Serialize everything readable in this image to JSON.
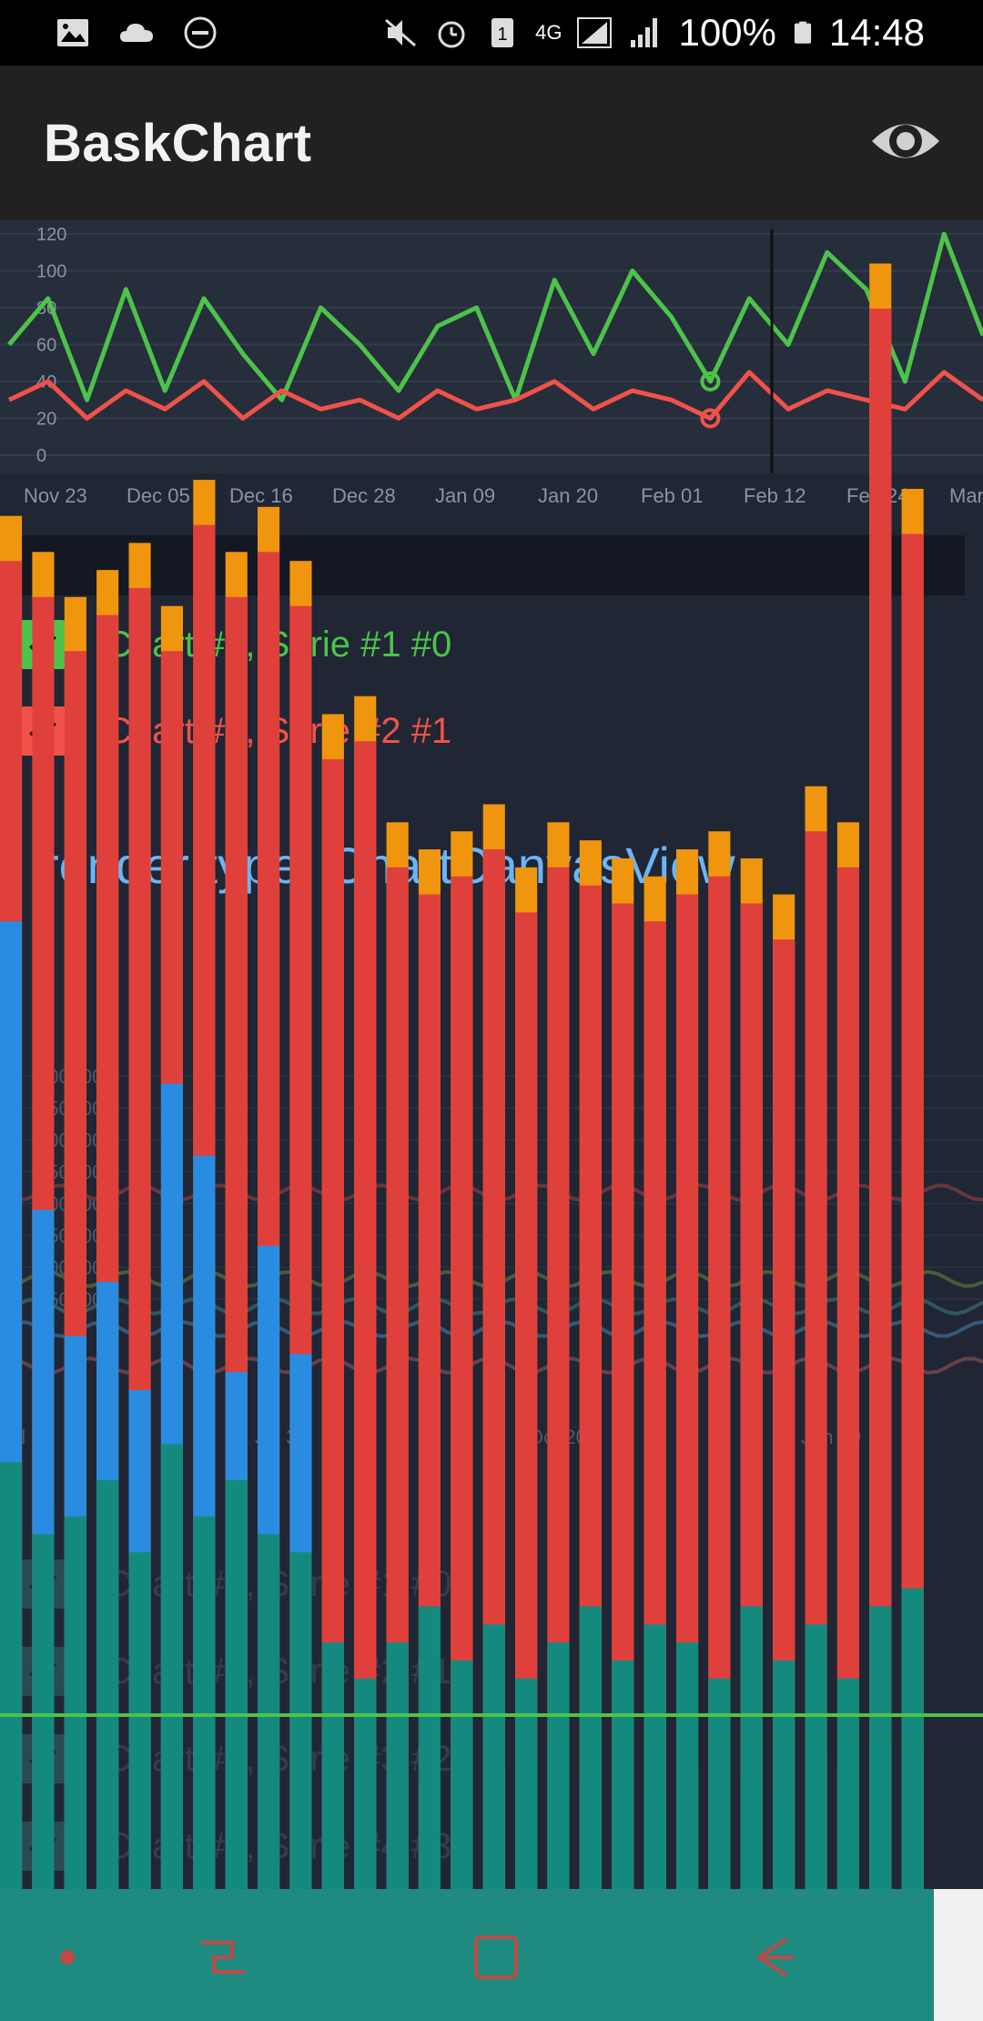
{
  "status_bar": {
    "battery": "100%",
    "time": "14:48",
    "network": "4G",
    "sim_slot": "1",
    "left_icons": [
      "image-icon",
      "cloud-icon",
      "dnd-icon"
    ],
    "right_icons": [
      "mute-icon",
      "alarm-icon",
      "sim-icon",
      "network-icon",
      "signal-icon",
      "signal-icon",
      "battery-icon"
    ]
  },
  "app_bar": {
    "title": "BaskChart",
    "action_icon": "eye-icon"
  },
  "chart3": {
    "x_ticks": [
      "Nov 23",
      "Dec 05",
      "Dec 16",
      "Dec 28",
      "Jan 09",
      "Jan 20",
      "Feb 01",
      "Feb 12",
      "Feb 24",
      "Mar"
    ],
    "y_ticks": [
      "0",
      "20",
      "40",
      "60",
      "80",
      "100",
      "120"
    ],
    "legend": [
      {
        "label": "Chart #3, Serie #1 #0",
        "color": "#4cc34a"
      },
      {
        "label": "Chart #3, Serie #2 #1",
        "color": "#f0524a"
      }
    ]
  },
  "render_type": "render type: ChartCanvasView",
  "chart4": {
    "y_ticks": [
      "5000000",
      "4500000",
      "4000000",
      "3500000",
      "3000000",
      "2500000",
      "2000000",
      "1500000"
    ],
    "x_ticks": [
      "Jul 11",
      "Jul 31",
      "Oct 20",
      "Jan 09"
    ],
    "legend": [
      {
        "label": "Chart #4, Serie #1 #0"
      },
      {
        "label": "Chart #4, Serie #2 #1"
      },
      {
        "label": "Chart #4, Serie #3 #2"
      },
      {
        "label": "Chart #4, Serie #4 #3"
      }
    ]
  },
  "chart_data": [
    {
      "type": "line",
      "x": [
        "Nov 23",
        "Dec 05",
        "Dec 16",
        "Dec 28",
        "Jan 09",
        "Jan 20",
        "Feb 01",
        "Feb 12",
        "Feb 24",
        "Mar"
      ],
      "ylim": [
        0,
        120
      ],
      "series": [
        {
          "name": "Chart #3, Serie #1 #0",
          "color": "#4cc34a",
          "values": [
            60,
            85,
            30,
            90,
            35,
            85,
            55,
            30,
            80,
            60,
            35,
            70,
            80,
            30,
            95,
            55,
            100,
            75,
            40,
            85,
            60,
            110,
            90,
            40,
            120,
            65
          ]
        },
        {
          "name": "Chart #3, Serie #2 #1",
          "color": "#f0524a",
          "values": [
            30,
            40,
            20,
            35,
            25,
            40,
            20,
            35,
            25,
            30,
            20,
            35,
            25,
            30,
            40,
            25,
            35,
            30,
            20,
            45,
            25,
            35,
            30,
            25,
            45,
            30
          ]
        }
      ]
    },
    {
      "type": "bar",
      "stacked": true,
      "series": [
        {
          "name": "orange",
          "color": "#f0960e",
          "values": [
            1670,
            1630,
            1580,
            1610,
            1640,
            1570,
            1710,
            1630,
            1680,
            1620,
            1450,
            1470,
            1330,
            1300,
            1320,
            1350,
            1280,
            1330,
            1310,
            1290,
            1270,
            1300,
            1320,
            1290,
            1250,
            1370,
            1330,
            1950,
            1700
          ]
        },
        {
          "name": "red",
          "color": "#e0403c",
          "values": [
            1620,
            1580,
            1520,
            1560,
            1590,
            1520,
            1660,
            1580,
            1630,
            1570,
            1400,
            1420,
            1280,
            1250,
            1270,
            1300,
            1230,
            1280,
            1260,
            1240,
            1220,
            1250,
            1270,
            1240,
            1200,
            1320,
            1280,
            1900,
            1650
          ]
        },
        {
          "name": "blue",
          "color": "#2a8ce0",
          "values": [
            1220,
            900,
            760,
            820,
            700,
            1040,
            960,
            720,
            860,
            740,
            320,
            300,
            280,
            260,
            310,
            280,
            290,
            300,
            270,
            260,
            250,
            280,
            300,
            270,
            260,
            300,
            280,
            310,
            300
          ]
        },
        {
          "name": "teal",
          "color": "#148a7e",
          "values": [
            620,
            540,
            560,
            600,
            520,
            640,
            560,
            600,
            540,
            520,
            420,
            380,
            420,
            460,
            400,
            440,
            380,
            420,
            460,
            400,
            440,
            420,
            380,
            460,
            400,
            440,
            380,
            460,
            480
          ]
        }
      ]
    }
  ],
  "nav_bar": {
    "icons": [
      "home-dot-icon",
      "recent-apps-icon",
      "home-square-icon",
      "back-icon"
    ]
  }
}
